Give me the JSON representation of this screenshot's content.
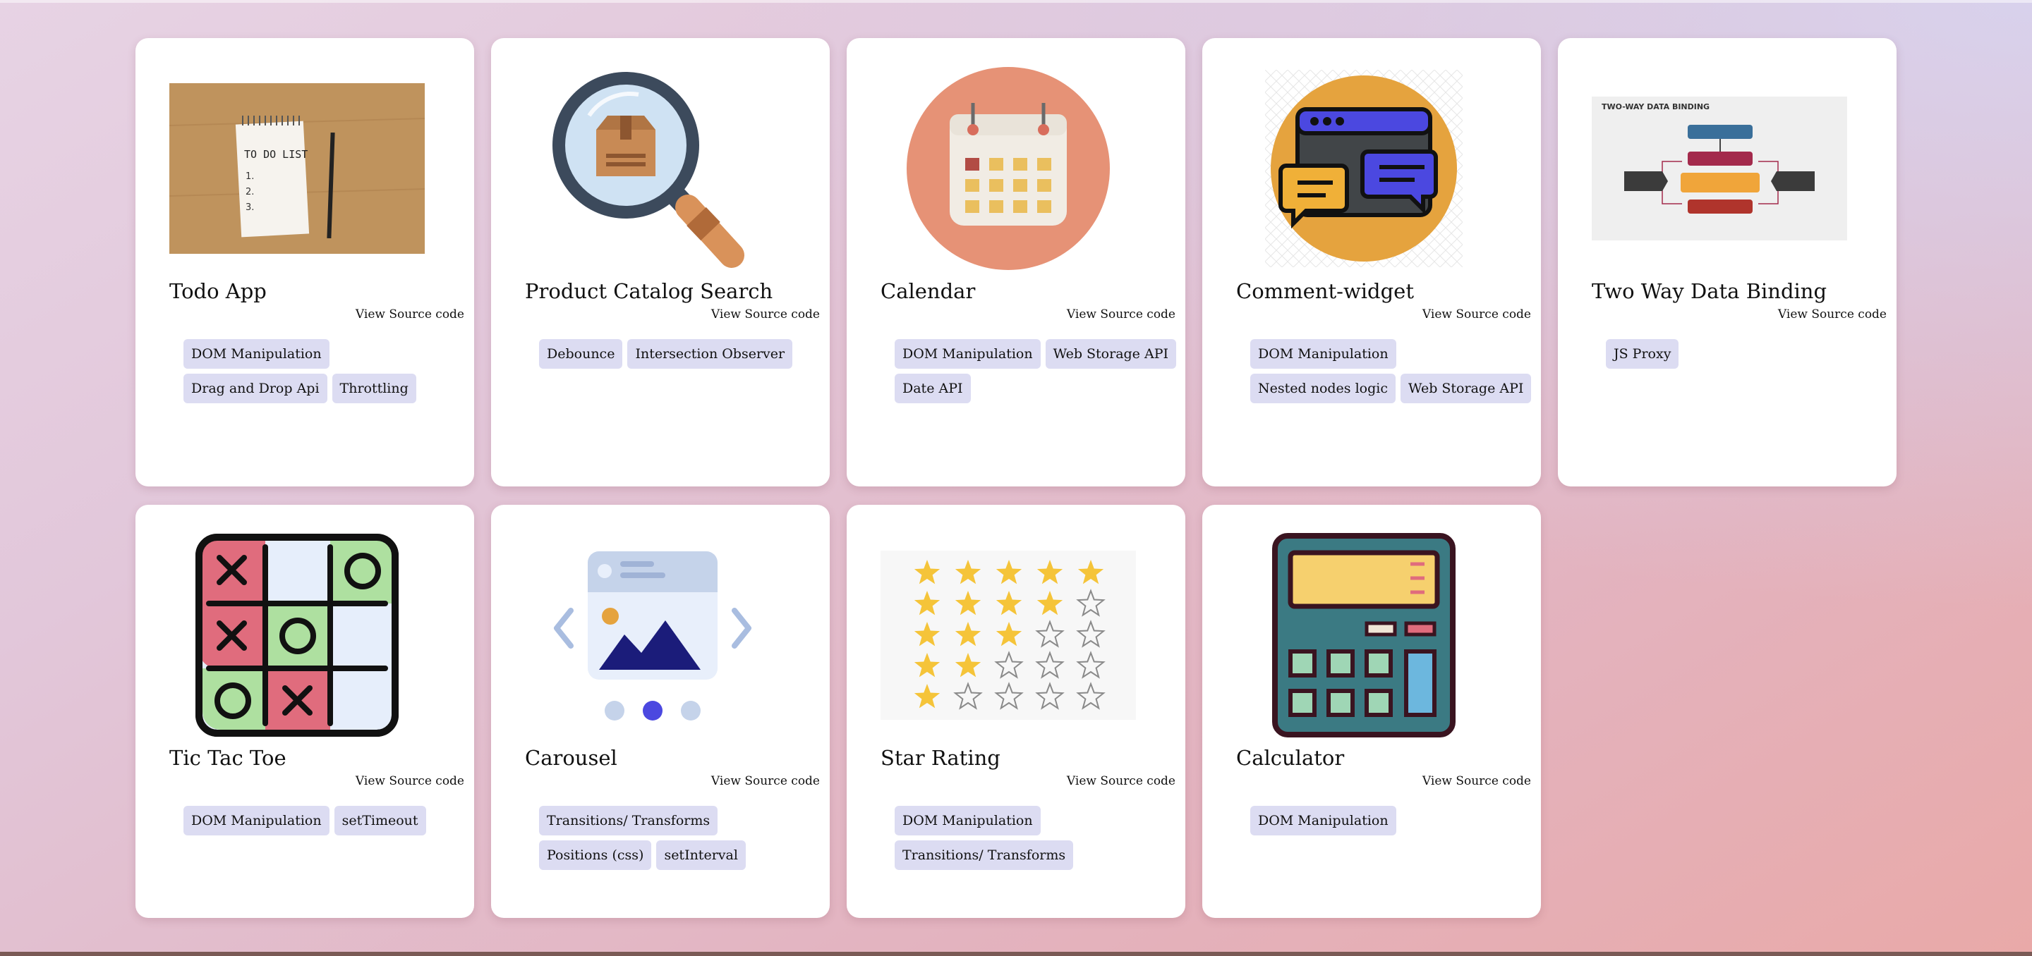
{
  "cards": [
    {
      "title": "Todo App",
      "source_label": "View Source code",
      "tags": [
        "DOM Manipulation",
        "Drag and Drop Api",
        "Throttling"
      ],
      "image_text": "TO DO LIST",
      "image_items": [
        "1.",
        "2.",
        "3."
      ]
    },
    {
      "title": "Product Catalog Search",
      "source_label": "View Source code",
      "tags": [
        "Debounce",
        "Intersection Observer"
      ]
    },
    {
      "title": "Calendar",
      "source_label": "View Source code",
      "tags": [
        "DOM Manipulation",
        "Web Storage API",
        "Date API"
      ]
    },
    {
      "title": "Comment-widget",
      "source_label": "View Source code",
      "tags": [
        "DOM Manipulation",
        "Nested nodes logic",
        "Web Storage API"
      ]
    },
    {
      "title": "Two Way Data Binding",
      "source_label": "View Source code",
      "tags": [
        "JS Proxy"
      ],
      "image_text": "TWO-WAY DATA BINDING"
    },
    {
      "title": "Tic Tac Toe",
      "source_label": "View Source code",
      "tags": [
        "DOM Manipulation",
        "setTimeout"
      ]
    },
    {
      "title": "Carousel",
      "source_label": "View Source code",
      "tags": [
        "Transitions/ Transforms",
        "Positions (css)",
        "setInterval"
      ]
    },
    {
      "title": "Star Rating",
      "source_label": "View Source code",
      "tags": [
        "DOM Manipulation",
        "Transitions/ Transforms"
      ],
      "ratings": [
        5,
        4,
        3,
        2,
        1
      ]
    },
    {
      "title": "Calculator",
      "source_label": "View Source code",
      "tags": [
        "DOM Manipulation"
      ]
    }
  ],
  "colors": {
    "tag_bg": "#dcdcf2",
    "card_bg": "#ffffff"
  }
}
